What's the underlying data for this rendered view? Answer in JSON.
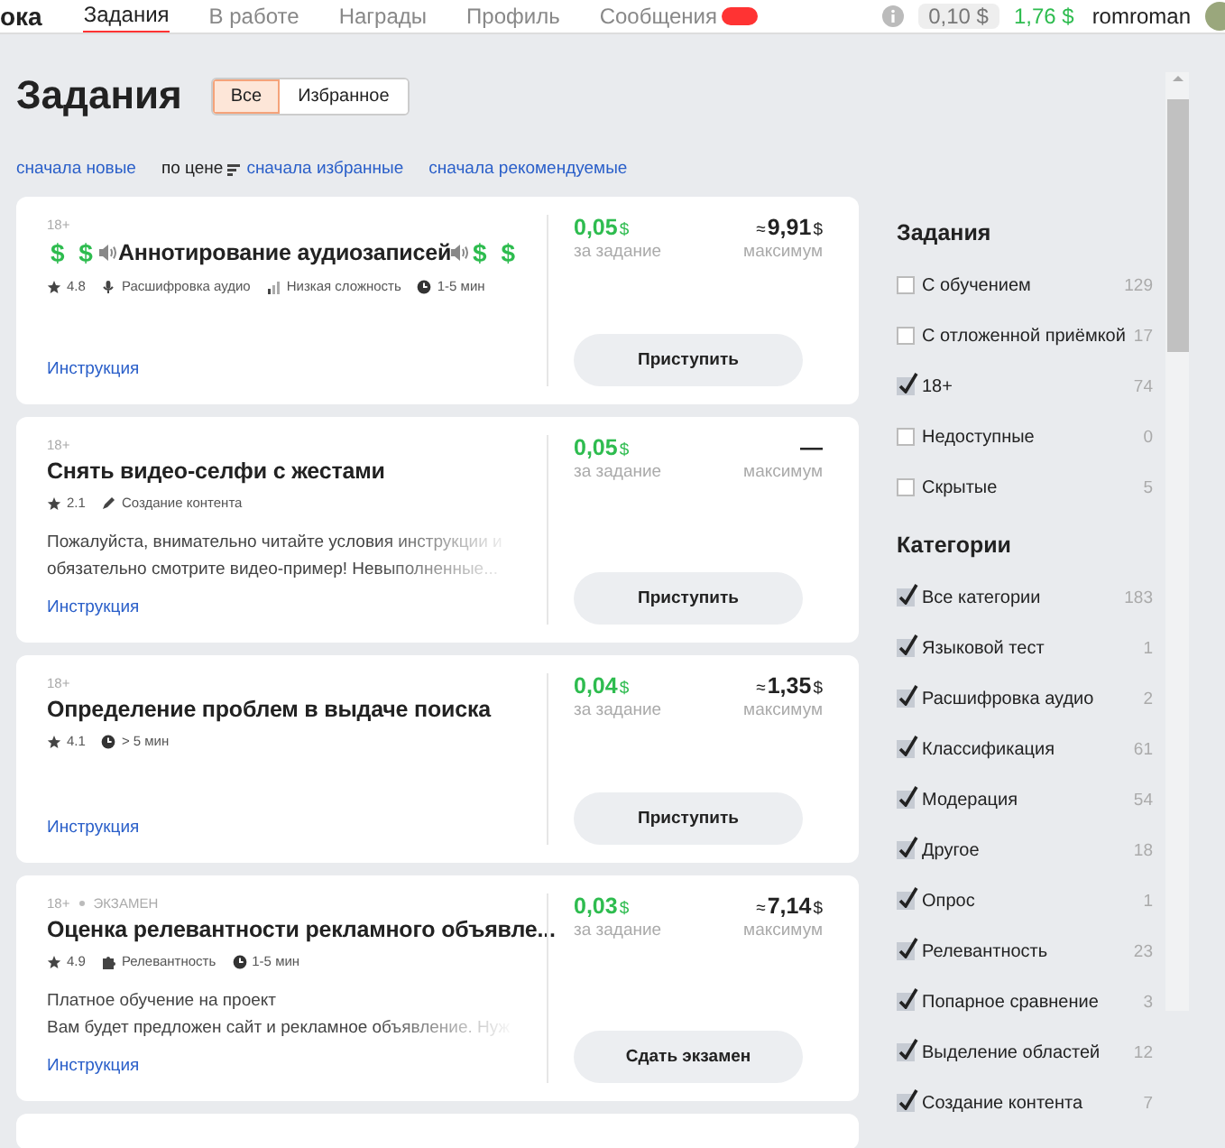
{
  "header": {
    "logo": "ока",
    "nav": [
      {
        "label": "Задания",
        "selected": true
      },
      {
        "label": "В работе",
        "selected": false
      },
      {
        "label": "Награды",
        "selected": false
      },
      {
        "label": "Профиль",
        "selected": false
      },
      {
        "label": "Сообщения",
        "selected": false,
        "badge": true
      }
    ],
    "balance": "0,10 $",
    "earned": "1,76 $",
    "user": "romroman"
  },
  "title": "Задания",
  "view_tabs": [
    {
      "label": "Все",
      "selected": true
    },
    {
      "label": "Избранное",
      "selected": false
    }
  ],
  "sort": [
    {
      "label": "сначала новые",
      "selected": false
    },
    {
      "label": "по цене",
      "selected": true
    },
    {
      "label": "сначала избранные",
      "selected": false
    },
    {
      "label": "сначала рекомендуемые",
      "selected": false
    }
  ],
  "tasks": [
    {
      "tags": [
        "18+"
      ],
      "title": [
        {
          "kind": "money",
          "text": "$ $"
        },
        {
          "kind": "speaker"
        },
        {
          "kind": "text",
          "text": "Аннотирование аудиозаписей"
        },
        {
          "kind": "speaker"
        },
        {
          "kind": "money",
          "text": "$ $"
        }
      ],
      "meta": [
        {
          "kind": "rating",
          "text": "4.8"
        },
        {
          "kind": "audio",
          "text": "Расшифровка аудио"
        },
        {
          "kind": "difficulty",
          "text": "Низкая сложность"
        },
        {
          "kind": "time",
          "text": "1-5 мин"
        }
      ],
      "instruction": "Инструкция",
      "reward": {
        "amount": "0,05",
        "currency": "$",
        "label": "за задание"
      },
      "max": {
        "approx": "≈",
        "amount": "9,91",
        "currency": "$",
        "label": "максимум"
      },
      "action": "Приступить"
    },
    {
      "tags": [
        "18+"
      ],
      "title": [
        {
          "kind": "text",
          "text": "Снять видео-селфи с жестами"
        }
      ],
      "meta": [
        {
          "kind": "rating",
          "text": "2.1"
        },
        {
          "kind": "content",
          "text": "Создание контента"
        }
      ],
      "description": [
        "Пожалуйста, внимательно читайте условия инструкции и",
        "обязательно смотрите видео-пример! Невыполненные..."
      ],
      "instruction": "Инструкция",
      "reward": {
        "amount": "0,05",
        "currency": "$",
        "label": "за задание"
      },
      "max": {
        "amount": "—",
        "label": "максимум"
      },
      "action": "Приступить"
    },
    {
      "tags": [
        "18+"
      ],
      "title": [
        {
          "kind": "text",
          "text": "Определение проблем в выдаче поиска"
        }
      ],
      "meta": [
        {
          "kind": "rating",
          "text": "4.1"
        },
        {
          "kind": "time",
          "text": "> 5 мин"
        }
      ],
      "instruction": "Инструкция",
      "reward": {
        "amount": "0,04",
        "currency": "$",
        "label": "за задание"
      },
      "max": {
        "approx": "≈",
        "amount": "1,35",
        "currency": "$",
        "label": "максимум"
      },
      "action": "Приступить"
    },
    {
      "tags": [
        "18+",
        "ЭКЗАМЕН"
      ],
      "title": [
        {
          "kind": "text",
          "text": "Оценка релевантности рекламного объявле..."
        }
      ],
      "meta": [
        {
          "kind": "rating",
          "text": "4.9"
        },
        {
          "kind": "relevance",
          "text": "Релевантность"
        },
        {
          "kind": "time",
          "text": "1-5 мин"
        }
      ],
      "description": [
        "Платное обучение на проект",
        "Вам будет предложен сайт и рекламное объявление. Нуж"
      ],
      "instruction": "Инструкция",
      "reward": {
        "amount": "0,03",
        "currency": "$",
        "label": "за задание"
      },
      "max": {
        "approx": "≈",
        "amount": "7,14",
        "currency": "$",
        "label": "максимум"
      },
      "action": "Сдать экзамен"
    }
  ],
  "filters": [
    {
      "title": "Задания",
      "items": [
        {
          "label": "С обучением",
          "count": "129",
          "checked": false
        },
        {
          "label": "С отложенной приёмкой",
          "count": "17",
          "checked": false
        },
        {
          "label": "18+",
          "count": "74",
          "checked": true
        },
        {
          "label": "Недоступные",
          "count": "0",
          "checked": false
        },
        {
          "label": "Скрытые",
          "count": "5",
          "checked": false
        }
      ]
    },
    {
      "title": "Категории",
      "items": [
        {
          "label": "Все категории",
          "count": "183",
          "checked": true
        },
        {
          "label": "Языковой тест",
          "count": "1",
          "checked": true
        },
        {
          "label": "Расшифровка аудио",
          "count": "2",
          "checked": true
        },
        {
          "label": "Классификация",
          "count": "61",
          "checked": true
        },
        {
          "label": "Модерация",
          "count": "54",
          "checked": true
        },
        {
          "label": "Другое",
          "count": "18",
          "checked": true
        },
        {
          "label": "Опрос",
          "count": "1",
          "checked": true
        },
        {
          "label": "Релевантность",
          "count": "23",
          "checked": true
        },
        {
          "label": "Попарное сравнение",
          "count": "3",
          "checked": true
        },
        {
          "label": "Выделение областей",
          "count": "12",
          "checked": true
        },
        {
          "label": "Создание контента",
          "count": "7",
          "checked": true
        }
      ]
    }
  ]
}
